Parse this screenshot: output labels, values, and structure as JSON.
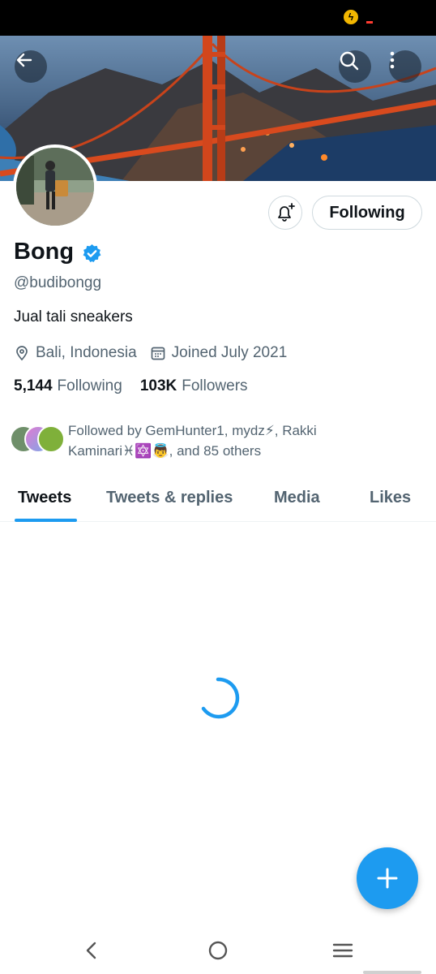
{
  "colors": {
    "accent": "#1d9bf0",
    "text": "#0f1419",
    "secondary": "#536471",
    "border": "#cfd9de"
  },
  "header": {
    "back_icon": "arrow-left-icon",
    "search_icon": "search-icon",
    "more_icon": "more-vertical-icon"
  },
  "profile": {
    "display_name": "Bong",
    "verified_icon": "verified-badge-icon",
    "handle": "@budibongg",
    "bio": "Jual tali sneakers",
    "location": "Bali, Indonesia",
    "joined": "Joined July 2021",
    "following_count": "5,144",
    "following_label": "Following",
    "followers_count": "103K",
    "followers_label": "Followers",
    "followed_by": "Followed by GemHunter1, mydz⚡, Rakki Kaminari♓🔯👼, and 85 others"
  },
  "actions": {
    "notify_icon": "bell-plus-icon",
    "follow_button": "Following"
  },
  "tabs": [
    {
      "label": "Tweets",
      "active": true
    },
    {
      "label": "Tweets & replies",
      "active": false
    },
    {
      "label": "Media",
      "active": false
    },
    {
      "label": "Likes",
      "active": false
    }
  ],
  "fab_icon": "plus-icon",
  "nav": {
    "back": "chevron-left-icon",
    "home": "circle-home-icon",
    "recents": "menu-lines-icon"
  }
}
